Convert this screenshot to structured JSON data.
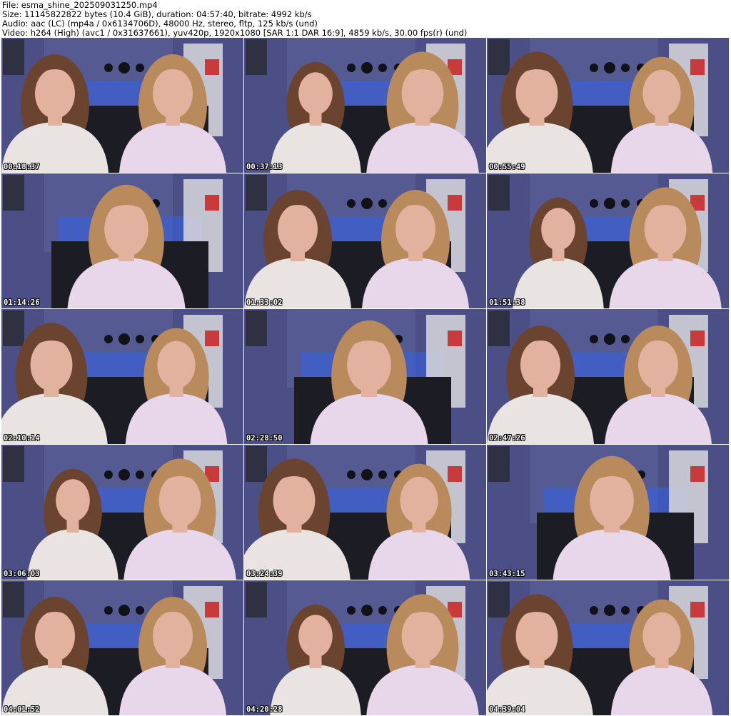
{
  "header": {
    "file_line": "File: esma_shine_202509031250.mp4",
    "size_line": "Size: 11145822822 bytes (10.4 GiB), duration: 04:57:40, bitrate: 4992 kb/s",
    "audio_line": "Audio: aac (LC) (mp4a / 0x6134706D), 48000 Hz, stereo, fltp, 125 kb/s (und)",
    "video_line": "Video: h264 (High) (avc1 / 0x31637661), yuv420p, 1920x1080 [SAR 1:1 DAR 16:9], 4859 kb/s, 30.00 fps(r) (und)"
  },
  "thumbnails": [
    {
      "timestamp": "00:18:37",
      "icon": "video-frame-thumbnail"
    },
    {
      "timestamp": "00:37:13",
      "icon": "video-frame-thumbnail"
    },
    {
      "timestamp": "00:55:49",
      "icon": "video-frame-thumbnail"
    },
    {
      "timestamp": "01:14:26",
      "icon": "video-frame-thumbnail"
    },
    {
      "timestamp": "01:33:02",
      "icon": "video-frame-thumbnail"
    },
    {
      "timestamp": "01:51:38",
      "icon": "video-frame-thumbnail"
    },
    {
      "timestamp": "02:10:14",
      "icon": "video-frame-thumbnail"
    },
    {
      "timestamp": "02:28:50",
      "icon": "video-frame-thumbnail"
    },
    {
      "timestamp": "02:47:26",
      "icon": "video-frame-thumbnail"
    },
    {
      "timestamp": "03:06:03",
      "icon": "video-frame-thumbnail"
    },
    {
      "timestamp": "03:24:39",
      "icon": "video-frame-thumbnail"
    },
    {
      "timestamp": "03:43:15",
      "icon": "video-frame-thumbnail"
    },
    {
      "timestamp": "04:01:52",
      "icon": "video-frame-thumbnail"
    },
    {
      "timestamp": "04:20:28",
      "icon": "video-frame-thumbnail"
    },
    {
      "timestamp": "04:39:04",
      "icon": "video-frame-thumbnail"
    }
  ],
  "colors": {
    "wall": "#4b4f86",
    "wall_light": "#6a6fa8",
    "blue_glow": "#2f63ff",
    "sofa": "#1c1c24",
    "hair_brown": "#6b4430",
    "hair_blonde": "#b88a5c",
    "skin": "#e2b29e",
    "shirt_pink": "#e8d6ea",
    "tank_white": "#e9e4e2",
    "shelf": "#d8d8dc",
    "shelf_red": "#c93a3a"
  }
}
